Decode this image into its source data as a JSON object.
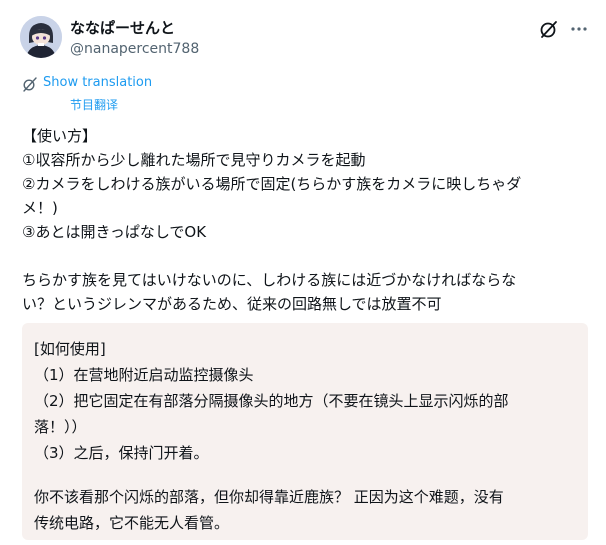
{
  "author": {
    "name": "ななぱーせんと",
    "handle": "@nanapercent788"
  },
  "toolbar": {
    "grok_icon": "grok-slash-icon",
    "more_icon": "more-horizontal-icon"
  },
  "translation": {
    "show_label": "Show translation",
    "translator_label": "节目翻译",
    "icon": "translate-icon"
  },
  "post": {
    "lines": [
      "【使い方】",
      "①収容所から少し離れた場所で見守りカメラを起動",
      "②カメラをしわける族がいる場所で固定(ちらかす族をカメラに映しちゃダ",
      "メ！)",
      "③あとは開きっぱなしでOK",
      "",
      "ちらかす族を見てはいけないのに、しわける族には近づかなければならな",
      "い？というジレンマがあるため、従来の回路無しでは放置不可"
    ]
  },
  "translated": {
    "lines": [
      "[如何使用]",
      "（1）在营地附近启动监控摄像头",
      "（2）把它固定在有部落分隔摄像头的地方（不要在镜头上显示闪烁的部",
      "落！））",
      "（3）之后，保持门开着。",
      "",
      "你不该看那个闪烁的部落，但你却得靠近鹿族？ 正因为这个难题，没有",
      "传统电路，它不能无人看管。"
    ]
  },
  "colors": {
    "link": "#1d9bf0",
    "text": "#0f1419",
    "muted": "#536471",
    "translation_box": "#f7f1ef"
  }
}
